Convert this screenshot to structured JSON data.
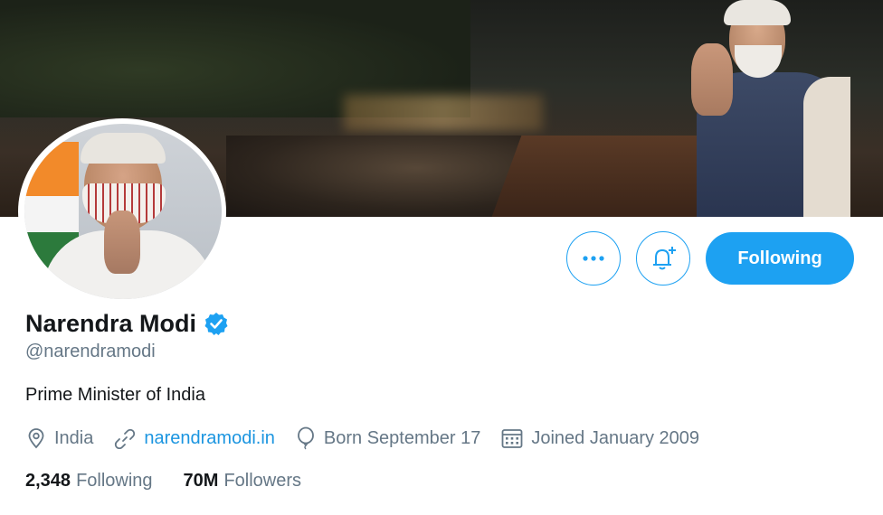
{
  "profile": {
    "name": "Narendra Modi",
    "handle": "@narendramodi",
    "bio": "Prime Minister of India",
    "location": "India",
    "website": "narendramodi.in",
    "birthday": "Born September 17",
    "joined": "Joined January 2009",
    "verified": true
  },
  "actions": {
    "more_icon": "more-horizontal-icon",
    "notify_icon": "bell-plus-icon",
    "follow_label": "Following"
  },
  "stats": {
    "following_count": "2,348",
    "following_label": "Following",
    "followers_count": "70M",
    "followers_label": "Followers"
  },
  "icons": {
    "location": "map-pin-icon",
    "website": "link-icon",
    "birthday": "balloon-icon",
    "joined": "calendar-icon",
    "verified": "verified-badge-icon"
  },
  "colors": {
    "accent": "#1da1f2",
    "link": "#1b95e0",
    "text_primary": "#14171a",
    "text_secondary": "#657786"
  }
}
